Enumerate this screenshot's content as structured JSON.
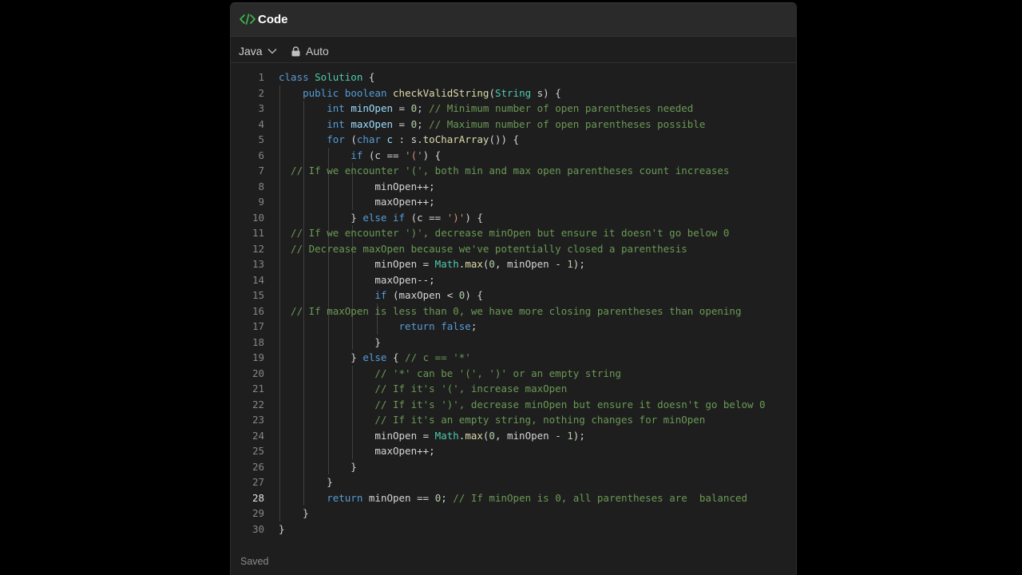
{
  "header": {
    "title": "Code",
    "icon": "code-brackets-icon",
    "accent_color": "#3fb950"
  },
  "toolbar": {
    "language": "Java",
    "mode": "Auto"
  },
  "editor": {
    "active_line": 28,
    "lines": [
      {
        "n": "1",
        "tokens": [
          {
            "t": "class ",
            "c": "kw"
          },
          {
            "t": "Solution",
            "c": "ty"
          },
          {
            "t": " {",
            "c": ""
          }
        ]
      },
      {
        "n": "2",
        "tokens": [
          {
            "t": "    public ",
            "c": "kw"
          },
          {
            "t": "boolean ",
            "c": "kw"
          },
          {
            "t": "checkValidString",
            "c": "fn"
          },
          {
            "t": "(",
            "c": ""
          },
          {
            "t": "String",
            "c": "ty"
          },
          {
            "t": " s) {",
            "c": ""
          }
        ]
      },
      {
        "n": "3",
        "tokens": [
          {
            "t": "        int ",
            "c": "kw"
          },
          {
            "t": "minOpen",
            "c": "var"
          },
          {
            "t": " = ",
            "c": ""
          },
          {
            "t": "0",
            "c": "num"
          },
          {
            "t": "; ",
            "c": ""
          },
          {
            "t": "// Minimum number of open parentheses needed",
            "c": "com"
          }
        ]
      },
      {
        "n": "4",
        "tokens": [
          {
            "t": "        int ",
            "c": "kw"
          },
          {
            "t": "maxOpen",
            "c": "var"
          },
          {
            "t": " = ",
            "c": ""
          },
          {
            "t": "0",
            "c": "num"
          },
          {
            "t": "; ",
            "c": ""
          },
          {
            "t": "// Maximum number of open parentheses possible",
            "c": "com"
          }
        ]
      },
      {
        "n": "5",
        "tokens": [
          {
            "t": "        for ",
            "c": "kw"
          },
          {
            "t": "(",
            "c": ""
          },
          {
            "t": "char ",
            "c": "kw"
          },
          {
            "t": "c",
            "c": "var"
          },
          {
            "t": " : s.",
            "c": ""
          },
          {
            "t": "toCharArray",
            "c": "fn"
          },
          {
            "t": "()) {",
            "c": ""
          }
        ]
      },
      {
        "n": "6",
        "tokens": [
          {
            "t": "            if ",
            "c": "kw"
          },
          {
            "t": "(c == ",
            "c": ""
          },
          {
            "t": "'('",
            "c": "str"
          },
          {
            "t": ") {",
            "c": ""
          }
        ]
      },
      {
        "n": "7",
        "tokens": [
          {
            "t": "  // If we encounter '(', both min and max open parentheses count increases",
            "c": "com"
          }
        ]
      },
      {
        "n": "8",
        "tokens": [
          {
            "t": "                minOpen++;",
            "c": ""
          }
        ]
      },
      {
        "n": "9",
        "tokens": [
          {
            "t": "                maxOpen++;",
            "c": ""
          }
        ]
      },
      {
        "n": "10",
        "tokens": [
          {
            "t": "            } ",
            "c": ""
          },
          {
            "t": "else if ",
            "c": "kw"
          },
          {
            "t": "(c == ",
            "c": ""
          },
          {
            "t": "')'",
            "c": "str"
          },
          {
            "t": ") {",
            "c": ""
          }
        ]
      },
      {
        "n": "11",
        "tokens": [
          {
            "t": "  // If we encounter ')', decrease minOpen but ensure it doesn't go below 0",
            "c": "com"
          }
        ]
      },
      {
        "n": "12",
        "tokens": [
          {
            "t": "  // Decrease maxOpen because we've potentially closed a parenthesis",
            "c": "com"
          }
        ]
      },
      {
        "n": "13",
        "tokens": [
          {
            "t": "                minOpen = ",
            "c": ""
          },
          {
            "t": "Math",
            "c": "ty"
          },
          {
            "t": ".",
            "c": ""
          },
          {
            "t": "max",
            "c": "fn"
          },
          {
            "t": "(",
            "c": ""
          },
          {
            "t": "0",
            "c": "num"
          },
          {
            "t": ", minOpen - ",
            "c": ""
          },
          {
            "t": "1",
            "c": "num"
          },
          {
            "t": ");",
            "c": ""
          }
        ]
      },
      {
        "n": "14",
        "tokens": [
          {
            "t": "                maxOpen--;",
            "c": ""
          }
        ]
      },
      {
        "n": "15",
        "tokens": [
          {
            "t": "                if ",
            "c": "kw"
          },
          {
            "t": "(maxOpen < ",
            "c": ""
          },
          {
            "t": "0",
            "c": "num"
          },
          {
            "t": ") {",
            "c": ""
          }
        ]
      },
      {
        "n": "16",
        "tokens": [
          {
            "t": "  // If maxOpen is less than 0, we have more closing parentheses than opening",
            "c": "com"
          }
        ]
      },
      {
        "n": "17",
        "tokens": [
          {
            "t": "                    return ",
            "c": "kw"
          },
          {
            "t": "false",
            "c": "kw"
          },
          {
            "t": ";",
            "c": ""
          }
        ]
      },
      {
        "n": "18",
        "tokens": [
          {
            "t": "                }",
            "c": ""
          }
        ]
      },
      {
        "n": "19",
        "tokens": [
          {
            "t": "            } ",
            "c": ""
          },
          {
            "t": "else",
            "c": "kw"
          },
          {
            "t": " { ",
            "c": ""
          },
          {
            "t": "// c == '*'",
            "c": "com"
          }
        ]
      },
      {
        "n": "20",
        "tokens": [
          {
            "t": "                // '*' can be '(', ')' or an empty string",
            "c": "com"
          }
        ]
      },
      {
        "n": "21",
        "tokens": [
          {
            "t": "                // If it's '(', increase maxOpen",
            "c": "com"
          }
        ]
      },
      {
        "n": "22",
        "tokens": [
          {
            "t": "                // If it's ')', decrease minOpen but ensure it doesn't go below 0",
            "c": "com"
          }
        ]
      },
      {
        "n": "23",
        "tokens": [
          {
            "t": "                // If it's an empty string, nothing changes for minOpen",
            "c": "com"
          }
        ]
      },
      {
        "n": "24",
        "tokens": [
          {
            "t": "                minOpen = ",
            "c": ""
          },
          {
            "t": "Math",
            "c": "ty"
          },
          {
            "t": ".",
            "c": ""
          },
          {
            "t": "max",
            "c": "fn"
          },
          {
            "t": "(",
            "c": ""
          },
          {
            "t": "0",
            "c": "num"
          },
          {
            "t": ", minOpen - ",
            "c": ""
          },
          {
            "t": "1",
            "c": "num"
          },
          {
            "t": ");",
            "c": ""
          }
        ]
      },
      {
        "n": "25",
        "tokens": [
          {
            "t": "                maxOpen++;",
            "c": ""
          }
        ]
      },
      {
        "n": "26",
        "tokens": [
          {
            "t": "            }",
            "c": ""
          }
        ]
      },
      {
        "n": "27",
        "tokens": [
          {
            "t": "        }",
            "c": ""
          }
        ]
      },
      {
        "n": "28",
        "tokens": [
          {
            "t": "        return ",
            "c": "kw"
          },
          {
            "t": "minOpen == ",
            "c": ""
          },
          {
            "t": "0",
            "c": "num"
          },
          {
            "t": "; ",
            "c": ""
          },
          {
            "t": "// If minOpen is 0, all parentheses are  balanced",
            "c": "com"
          }
        ]
      },
      {
        "n": "29",
        "tokens": [
          {
            "t": "    }",
            "c": ""
          }
        ]
      },
      {
        "n": "30",
        "tokens": [
          {
            "t": "}",
            "c": ""
          }
        ]
      }
    ]
  },
  "status": {
    "text": "Saved"
  }
}
